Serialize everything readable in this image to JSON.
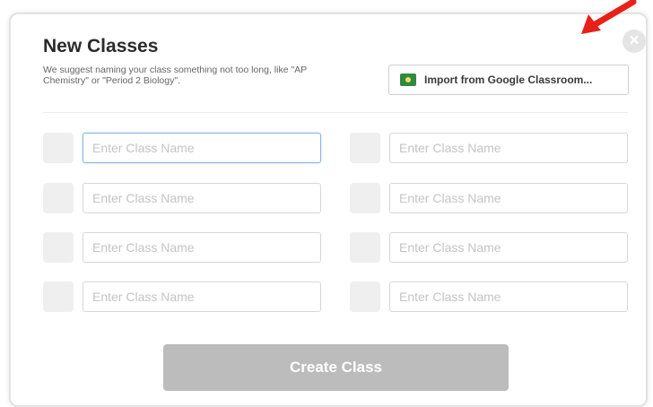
{
  "modal": {
    "title": "New Classes",
    "subtitle": "We suggest naming your class something not too long, like \"AP Chemistry\" or \"Period 2 Biology\".",
    "close_glyph": "×",
    "close_icon": "close-icon",
    "import_button": {
      "label": "Import from Google Classroom...",
      "icon": "google-classroom-icon",
      "icon_color": "#2e8b3e"
    },
    "class_inputs": [
      {
        "placeholder": "Enter Class Name",
        "value": "",
        "focused": true
      },
      {
        "placeholder": "Enter Class Name",
        "value": ""
      },
      {
        "placeholder": "Enter Class Name",
        "value": ""
      },
      {
        "placeholder": "Enter Class Name",
        "value": ""
      },
      {
        "placeholder": "Enter Class Name",
        "value": ""
      },
      {
        "placeholder": "Enter Class Name",
        "value": ""
      },
      {
        "placeholder": "Enter Class Name",
        "value": ""
      },
      {
        "placeholder": "Enter Class Name",
        "value": ""
      }
    ],
    "create_button": {
      "label": "Create Class",
      "disabled": true
    }
  },
  "annotation": {
    "arrow_color": "#e8201a",
    "arrow_icon": "red-arrow-icon"
  },
  "colors": {
    "focus_border": "#8ab4e0",
    "disabled_button": "#bcbcbc",
    "swatch": "#efefef"
  }
}
